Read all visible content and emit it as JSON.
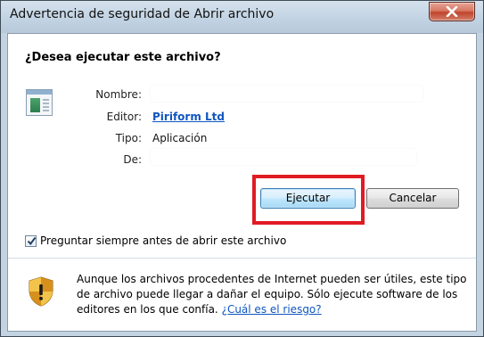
{
  "window": {
    "title": "Advertencia de seguridad de Abrir archivo",
    "close_icon": "close-x-icon"
  },
  "question": "¿Desea ejecutar este archivo?",
  "file": {
    "icon": "executable-file-icon",
    "fields": {
      "name_label": "Nombre:",
      "name_value": "",
      "publisher_label": "Editor:",
      "publisher_value": "Piriform Ltd",
      "type_label": "Tipo:",
      "type_value": "Aplicación",
      "from_label": "De:",
      "from_value": ""
    }
  },
  "buttons": {
    "run_label": "Ejecutar",
    "cancel_label": "Cancelar"
  },
  "checkbox": {
    "label": "Preguntar siempre antes de abrir este archivo",
    "checked": true
  },
  "warning": {
    "icon": "security-shield-icon",
    "text": "Aunque los archivos procedentes de Internet pueden ser útiles, este tipo de archivo puede llegar a dañar el equipo. Sólo ejecute software de los editores en los que confía.",
    "link_text": "¿Cuál es el riesgo?"
  },
  "colors": {
    "highlight": "#e01b24",
    "link": "#0f56c0"
  }
}
